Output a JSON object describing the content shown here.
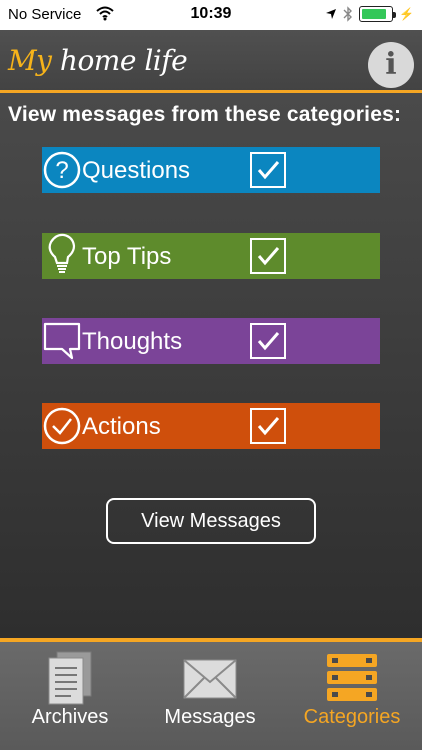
{
  "status_bar": {
    "carrier": "No Service",
    "time": "10:39",
    "battery_level": 0.85
  },
  "header": {
    "logo_my": "My",
    "logo_rest": "home life",
    "info_icon": "info-icon",
    "info_glyph": "i"
  },
  "section_title": "View messages from these categories:",
  "categories": [
    {
      "label": "Questions",
      "color": "#0b86c0",
      "icon": "question-circle-icon",
      "checked": true
    },
    {
      "label": "Top Tips",
      "color": "#5e8b2c",
      "icon": "lightbulb-icon",
      "checked": true
    },
    {
      "label": "Thoughts",
      "color": "#7b4498",
      "icon": "speech-bubble-icon",
      "checked": true
    },
    {
      "label": "Actions",
      "color": "#cf4f0c",
      "icon": "check-circle-icon",
      "checked": true
    }
  ],
  "view_button": "View Messages",
  "tabs": [
    {
      "label": "Archives",
      "icon": "document-icon",
      "active": false
    },
    {
      "label": "Messages",
      "icon": "envelope-icon",
      "active": false
    },
    {
      "label": "Categories",
      "icon": "categories-stack-icon",
      "active": true
    }
  ],
  "colors": {
    "accent": "#f5a623"
  }
}
